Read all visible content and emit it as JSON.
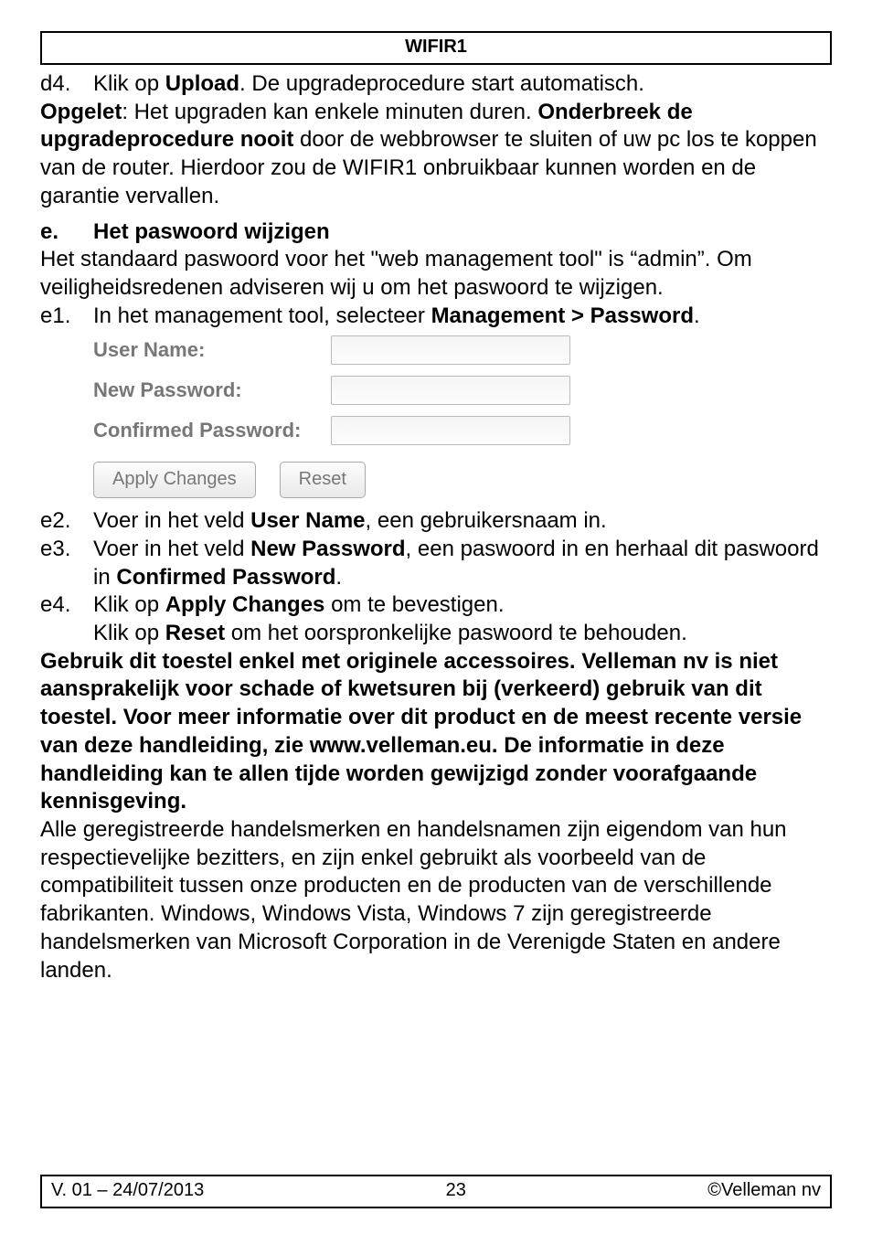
{
  "header": {
    "title": "WIFIR1"
  },
  "d4": {
    "num": "d4.",
    "line1_a": "Klik op ",
    "line1_b": "Upload",
    "line1_c": ". De upgradeprocedure start automatisch."
  },
  "opgelet": {
    "a": "Opgelet",
    "b": ": Het upgraden kan enkele minuten duren. ",
    "c": "Onderbreek de upgradeprocedure nooit",
    "d": " door de webbrowser te sluiten of uw pc los te koppen van de router. Hierdoor zou de WIFIR1 onbruikbaar kunnen worden en de garantie vervallen."
  },
  "sec_e": {
    "num": "e.",
    "title": "Het paswoord wijzigen"
  },
  "e_intro": "Het standaard paswoord voor het \"web management tool\" is “admin”. Om veiligheidsredenen adviseren wij u om het paswoord te wijzigen.",
  "e1": {
    "num": "e1.",
    "a": "In het management tool, selecteer ",
    "b": "Management > Password",
    "c": "."
  },
  "form": {
    "user": "User Name:",
    "newpw": "New Password:",
    "confpw": "Confirmed Password:",
    "apply": "Apply Changes",
    "reset": "Reset"
  },
  "e2": {
    "num": "e2.",
    "a": "Voer in het veld ",
    "b": "User Name",
    "c": ", een gebruikersnaam in."
  },
  "e3": {
    "num": "e3.",
    "a": "Voer in het veld ",
    "b": "New Password",
    "c": ", een paswoord in en herhaal dit paswoord in ",
    "d": "Confirmed Password",
    "e": "."
  },
  "e4": {
    "num": "e4.",
    "a": "Klik op ",
    "b": "Apply Changes",
    "c": " om te bevestigen.",
    "d": "Klik op ",
    "e": "Reset",
    "f": " om het oorspronkelijke paswoord te behouden."
  },
  "boldpara": "Gebruik dit toestel enkel met originele accessoires. Velleman nv is niet aansprakelijk voor schade of kwetsuren bij (verkeerd) gebruik van dit toestel. Voor meer informatie over dit product en de meest recente versie van deze handleiding, zie www.velleman.eu. De informatie in deze handleiding kan te allen tijde worden gewijzigd zonder voorafgaande kennisgeving.",
  "trailpara": "Alle geregistreerde handelsmerken en handelsnamen zijn eigendom van hun respectievelijke bezitters, en zijn enkel gebruikt als voorbeeld van de compatibiliteit tussen onze producten en de producten van de verschillende fabrikanten. Windows, Windows Vista, Windows 7 zijn geregistreerde handelsmerken van Microsoft Corporation in de Verenigde Staten en andere landen.",
  "footer": {
    "left": "V. 01 – 24/07/2013",
    "mid": "23",
    "right": "©Velleman nv"
  }
}
